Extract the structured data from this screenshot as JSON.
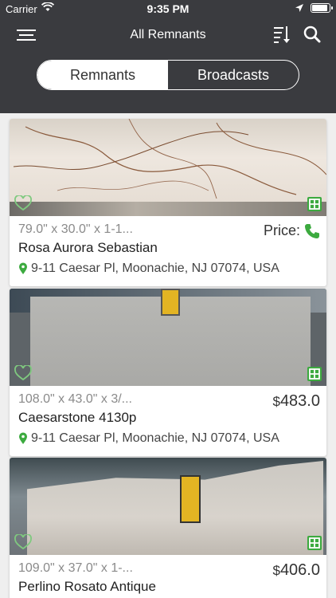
{
  "status_bar": {
    "carrier": "Carrier",
    "time": "9:35 PM",
    "battery_level": 0.9
  },
  "nav": {
    "title": "All Remnants"
  },
  "segments": {
    "remnants": "Remnants",
    "broadcasts": "Broadcasts",
    "selected": "Remnants"
  },
  "colors": {
    "header_bg": "#3a3b3f",
    "accent_green": "#3caa3f"
  },
  "cards": [
    {
      "dims": "79.0\" x 30.0\" x 1-1...",
      "name": "Rosa Aurora Sebastian",
      "address": "9-11 Caesar Pl, Moonachie, NJ 07074, USA",
      "price_label": "Price:",
      "price": null
    },
    {
      "dims": "108.0\" x 43.0\" x 3/...",
      "name": "Caesarstone 4130p",
      "address": "9-11 Caesar Pl, Moonachie, NJ 07074, USA",
      "currency": "$",
      "price": "483.0"
    },
    {
      "dims": "109.0\" x 37.0\" x 1-...",
      "name": "Perlino Rosato Antique",
      "currency": "$",
      "price": "406.0"
    }
  ]
}
